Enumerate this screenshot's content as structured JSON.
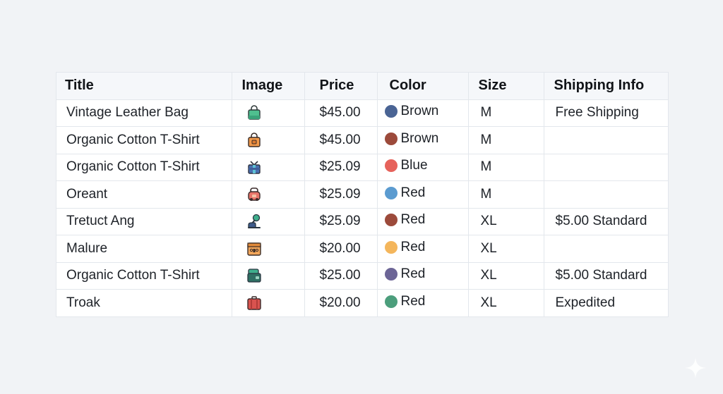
{
  "table": {
    "headers": {
      "title": "Title",
      "image": "Image",
      "price": "Price",
      "color": "Color",
      "size": "Size",
      "shipping": "Shipping Info"
    },
    "rows": [
      {
        "title": "Vintage Leather Bag",
        "icon": "green-shopping-bag-icon",
        "price": "$45.00",
        "color_label": "Brown",
        "dot_color": "#4a6494",
        "size": "M",
        "shipping": "Free Shipping"
      },
      {
        "title": "Organic Cotton T-Shirt",
        "icon": "orange-tote-bag-icon",
        "price": "$45.00",
        "color_label": "Brown",
        "dot_color": "#9c4a3b",
        "size": "M",
        "shipping": ""
      },
      {
        "title": "Organic Cotton T-Shirt",
        "icon": "blue-gift-box-icon",
        "price": "$25.09",
        "color_label": "Blue",
        "dot_color": "#e6625b",
        "size": "M",
        "shipping": ""
      },
      {
        "title": "Oreant",
        "icon": "red-backpack-icon",
        "price": "$25.09",
        "color_label": "Red",
        "dot_color": "#5b9bd0",
        "size": "M",
        "shipping": ""
      },
      {
        "title": "Tretuct Ang",
        "icon": "teal-lamp-icon",
        "price": "$25.09",
        "color_label": "Red",
        "dot_color": "#9c4a3b",
        "size": "XL",
        "shipping": "$5.00 Standard"
      },
      {
        "title": "Malure",
        "icon": "orange-chest-icon",
        "price": "$20.00",
        "color_label": "Red",
        "dot_color": "#f4b65c",
        "size": "XL",
        "shipping": ""
      },
      {
        "title": "Organic Cotton T-Shirt",
        "icon": "green-wallet-icon",
        "price": "$25.00",
        "color_label": "Red",
        "dot_color": "#6c6596",
        "size": "XL",
        "shipping": "$5.00 Standard"
      },
      {
        "title": "Troak",
        "icon": "red-suitcase-icon",
        "price": "$20.00",
        "color_label": "Red",
        "dot_color": "#4c9e7c",
        "size": "XL",
        "shipping": "Expedited"
      }
    ]
  },
  "decor": {
    "sparkle_icon": "sparkle-icon",
    "background_color": "#f1f3f6"
  }
}
